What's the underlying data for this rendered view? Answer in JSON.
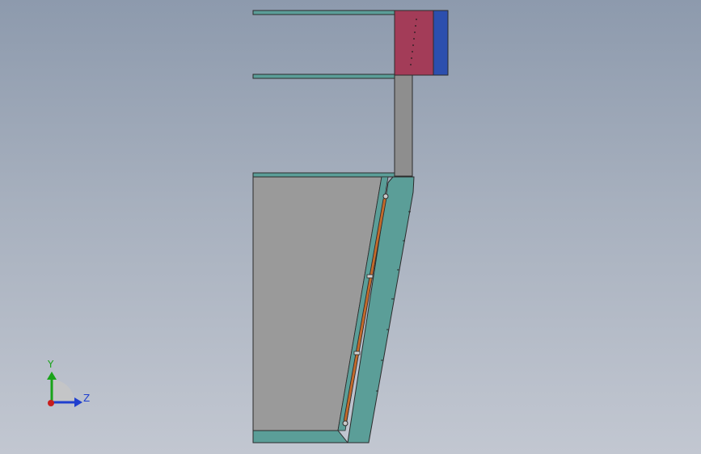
{
  "viewport": {
    "background_top": "#8d9aad",
    "background_bottom": "#c2c7d1"
  },
  "colors": {
    "teal_part": "#5b9e98",
    "teal_dark": "#2f5e5a",
    "grey_body": "#9a9a9a",
    "grey_post": "#8e8e8e",
    "red_block": "#a33c58",
    "blue_block": "#2c4fae",
    "orange_rod": "#c36a2a",
    "outline": "#2b2b2b"
  },
  "triad": {
    "y_label": "Y",
    "z_label": "Z",
    "y_color": "#19a319",
    "z_color": "#1f3fcf",
    "x_color": "#c81e1e"
  }
}
